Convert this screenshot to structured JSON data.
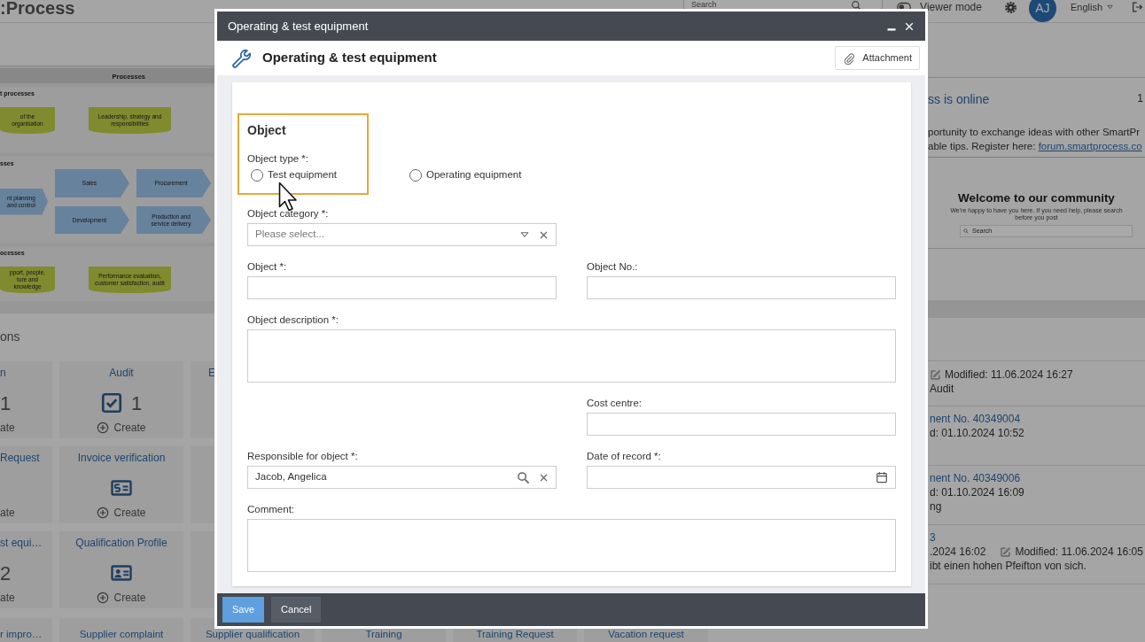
{
  "topbar": {
    "logo": ":Process",
    "search": {
      "placeholder": "Search"
    },
    "viewer_mode": {
      "label": "Viewer mode",
      "on": false
    },
    "avatar": "AJ",
    "language": "English"
  },
  "process_map": {
    "title": "Processes",
    "sections": [
      {
        "label": "t processes",
        "shapes": [
          {
            "kind": "support",
            "text": "of the organisation"
          },
          {
            "kind": "support",
            "text": "Leadership, strategy and responsibilities"
          }
        ]
      },
      {
        "label": "sses",
        "shapes": [
          {
            "kind": "core",
            "text": "nt planning and control"
          },
          {
            "kind": "core",
            "text": "Sales"
          },
          {
            "kind": "core",
            "text": "Procurement"
          },
          {
            "kind": "core",
            "text": "Development"
          },
          {
            "kind": "core",
            "text": "Production and service delivery"
          }
        ]
      },
      {
        "label": "ocesses",
        "shapes": [
          {
            "kind": "support",
            "text": "pport, people, ture and knowledge"
          },
          {
            "kind": "support",
            "text": "Performance evaluation, customer satisfaction, audit"
          }
        ]
      }
    ]
  },
  "tiles_heading": "ons",
  "tile_rows": [
    [
      {
        "kind": "count",
        "title": "n",
        "count": "1",
        "action": "ate"
      },
      {
        "kind": "checklist",
        "title": "Audit",
        "count": "1",
        "action": "Create"
      },
      {
        "kind": "plain",
        "title": "E"
      }
    ],
    [
      {
        "kind": "plain",
        "title": "Request",
        "action": "ate"
      },
      {
        "kind": "invoice",
        "title": "Invoice verification",
        "action": "Create"
      },
      {
        "kind": "plain"
      }
    ],
    [
      {
        "kind": "count",
        "title": "st equi…",
        "count": "2",
        "action": "ate"
      },
      {
        "kind": "profile",
        "title": "Qualification Profile",
        "action": "Create"
      },
      {
        "kind": "plain"
      }
    ]
  ],
  "tile_bottom_row": [
    "r impro…",
    "Supplier complaint",
    "Supplier qualification",
    "Training",
    "Training Request",
    "Vacation request"
  ],
  "news": {
    "title": "ss is online",
    "count": "1",
    "line_1": "portunity to exchange ideas with other SmartPr",
    "line_2": "able tips. Register here: ",
    "link": "forum.smartprocess.co"
  },
  "community": {
    "title": "Welcome to our community",
    "subtitle": "We're happy to have you here. If you need help, please search before you post",
    "search": {
      "placeholder": "Search"
    }
  },
  "activities": [
    {
      "lines": [
        [
          {
            "kind": "modified",
            "text": "Modified: 11.06.2024 16:27"
          }
        ],
        [
          {
            "kind": "text",
            "text": "Audit"
          }
        ]
      ]
    },
    {
      "lines": [
        [
          {
            "kind": "link",
            "text": "nent No. 40349004"
          }
        ],
        [
          {
            "kind": "text",
            "text": "d: 01.10.2024 10:52"
          }
        ]
      ]
    },
    {
      "lines": [
        [
          {
            "kind": "link",
            "text": "nent No. 40349006"
          }
        ],
        [
          {
            "kind": "text",
            "text": "d: 01.10.2024 16:09"
          }
        ],
        [
          {
            "kind": "text",
            "text": "ng"
          }
        ]
      ]
    },
    {
      "lines": [
        [
          {
            "kind": "link",
            "text": "3"
          }
        ],
        [
          {
            "kind": "text",
            "text": ".2024 16:02"
          },
          {
            "kind": "modified",
            "text": "Modified: 11.06.2024 16:05"
          }
        ],
        [
          {
            "kind": "text",
            "text": "ibt einen hohen Pfeifton von sich."
          }
        ]
      ]
    }
  ],
  "modal": {
    "title": "Operating & test equipment",
    "heading": "Operating & test equipment",
    "attachment": "Attachment",
    "section": {
      "title": "Object",
      "highlighted": true
    },
    "object_type": {
      "label": "Object type *:",
      "options": [
        {
          "label": "Test equipment",
          "selected": false
        },
        {
          "label": "Operating equipment",
          "selected": false
        }
      ]
    },
    "rows": [
      {
        "left": {
          "kind": "select",
          "label": "Object category *:",
          "placeholder": "Please select..."
        }
      },
      {
        "left": {
          "kind": "text",
          "label": "Object *:"
        },
        "right": {
          "kind": "text",
          "label": "Object No.:"
        }
      },
      {
        "wide": {
          "kind": "textarea",
          "label": "Object description *:"
        }
      },
      {
        "right": {
          "kind": "text",
          "label": "Cost centre:"
        }
      },
      {
        "left": {
          "kind": "lookup",
          "label": "Responsible for object *:",
          "value": "Jacob, Angelica"
        },
        "right": {
          "kind": "date",
          "label": "Date of record *:"
        }
      },
      {
        "wide": {
          "kind": "textarea",
          "label": "Comment:"
        }
      }
    ],
    "buttons": [
      {
        "kind": "primary",
        "label": "Save"
      },
      {
        "kind": "secondary",
        "label": "Cancel"
      }
    ]
  }
}
